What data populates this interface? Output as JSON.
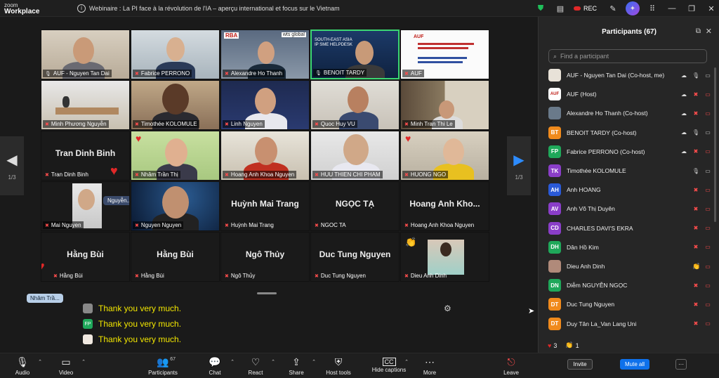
{
  "app": {
    "logo_line1": "zoom",
    "logo_line2": "Workplace",
    "meeting_title": "Webinaire : La PI face à la révolution de l'IA – aperçu international et focus sur le Vietnam",
    "rec_label": "REC"
  },
  "stage": {
    "page_left": "1/3",
    "page_right": "1/3",
    "tiles": [
      {
        "name": "AUF - Nguyen Tan Dai",
        "muted": false
      },
      {
        "name": "Fabrice PERRONO",
        "muted": true
      },
      {
        "name": "Alexandre Ho Thanh",
        "muted": true
      },
      {
        "name": "BENOIT TARDY",
        "muted": false
      },
      {
        "name": "AUF",
        "muted": true
      },
      {
        "name": "Minh Phương Nguyễn",
        "muted": true
      },
      {
        "name": "Timothée KOLOMULE",
        "muted": true
      },
      {
        "name": "Linh Nguyen",
        "muted": true
      },
      {
        "name": "Quoc Huy VU",
        "muted": true
      },
      {
        "name": "Minh Tran Thi Le",
        "muted": true
      },
      {
        "name": "Tran Dinh Binh",
        "big": "Tran Dinh Binh",
        "muted": true
      },
      {
        "name": "Nhâm Trần Thị",
        "muted": true
      },
      {
        "name": "Hoang Anh Khoa Nguyen",
        "muted": true
      },
      {
        "name": "HUU THIEN CHI PHAM",
        "muted": true
      },
      {
        "name": "HUONG NGO",
        "muted": true
      },
      {
        "name": "Mai Nguyen",
        "muted": true
      },
      {
        "name": "Nguyen Nguyen",
        "muted": true
      },
      {
        "name": "Huỳnh Mai Trang",
        "big": "Huỳnh Mai Trang",
        "muted": true
      },
      {
        "name": "NGOC TA",
        "big": "NGỌC TẠ",
        "muted": true
      },
      {
        "name": "Hoang Anh Khoa Nguyen",
        "big": "Hoang Anh Kho...",
        "muted": true
      },
      {
        "name": "Hằng Bùi",
        "big": "Hằng Bùi",
        "muted": true
      },
      {
        "name": "Hằng Bùi",
        "big": "Hằng Bùi",
        "muted": true
      },
      {
        "name": "Ngô Thủy",
        "big": "Ngô Thủy",
        "muted": true
      },
      {
        "name": "Duc Tung Nguyen",
        "big": "Duc Tung Nguyen",
        "muted": true
      },
      {
        "name": "Dieu Anh Dinh",
        "muted": true
      }
    ],
    "speaking_badge": "Nguyễn...",
    "hover_badge": "Nhâm Trầ...",
    "chat": [
      {
        "avatar": "",
        "text": "Thank you very much."
      },
      {
        "avatar": "FP",
        "text": "Thank you very much."
      },
      {
        "avatar": "",
        "text": "Thank you very much."
      }
    ]
  },
  "toolbar": {
    "audio": "Audio",
    "video": "Video",
    "participants": "Participants",
    "participants_count": "67",
    "chat": "Chat",
    "react": "React",
    "share": "Share",
    "host_tools": "Host tools",
    "hide_captions": "Hide captions",
    "more": "More",
    "leave": "Leave"
  },
  "panel": {
    "title": "Participants (67)",
    "search_placeholder": "Find a participant",
    "participants": [
      {
        "initials": "",
        "color": "#e8e2d8",
        "name": "AUF - Nguyen Tan Dai (Co-host, me)",
        "cloud": true,
        "muted": false,
        "clap": false
      },
      {
        "initials": "AUF",
        "color": "#ffffff",
        "name": "AUF (Host)",
        "cloud": true,
        "muted": true,
        "clap": false
      },
      {
        "initials": "",
        "color": "#6a7a8a",
        "name": "Alexandre Ho Thanh (Co-host)",
        "cloud": true,
        "muted": true,
        "clap": false
      },
      {
        "initials": "BT",
        "color": "#f08a1c",
        "name": "BENOIT TARDY (Co-host)",
        "cloud": true,
        "muted": false,
        "clap": false
      },
      {
        "initials": "FP",
        "color": "#1fa85a",
        "name": "Fabrice PERRONO (Co-host)",
        "cloud": true,
        "muted": true,
        "clap": false
      },
      {
        "initials": "TK",
        "color": "#8a3ec8",
        "name": "Timothée KOLOMULE",
        "cloud": false,
        "muted": false,
        "clap": false
      },
      {
        "initials": "AH",
        "color": "#2a5ad8",
        "name": "Anh HOANG",
        "cloud": false,
        "muted": true,
        "clap": false
      },
      {
        "initials": "AV",
        "color": "#8a3ec8",
        "name": "Anh Võ Thị Duyên",
        "cloud": false,
        "muted": true,
        "clap": false
      },
      {
        "initials": "CD",
        "color": "#8a3ec8",
        "name": "CHARLES DAVI'S EKRA",
        "cloud": false,
        "muted": true,
        "clap": false
      },
      {
        "initials": "DH",
        "color": "#1fa85a",
        "name": "Dân Hồ Kim",
        "cloud": false,
        "muted": true,
        "clap": false
      },
      {
        "initials": "",
        "color": "#b08a7a",
        "name": "Dieu Anh Dinh",
        "cloud": false,
        "muted": true,
        "clap": true
      },
      {
        "initials": "DN",
        "color": "#1fa85a",
        "name": "Diễm NGUYỄN NGỌC",
        "cloud": false,
        "muted": true,
        "clap": false
      },
      {
        "initials": "DT",
        "color": "#f08a1c",
        "name": "Duc Tung Nguyen",
        "cloud": false,
        "muted": true,
        "clap": false
      },
      {
        "initials": "DT",
        "color": "#f08a1c",
        "name": "Duy Tân La_Van Lang Uni",
        "cloud": false,
        "muted": true,
        "clap": false
      }
    ],
    "reactions": {
      "hearts": "3",
      "claps": "1"
    },
    "invite": "Invite",
    "mute_all": "Mute all",
    "more": "···"
  }
}
